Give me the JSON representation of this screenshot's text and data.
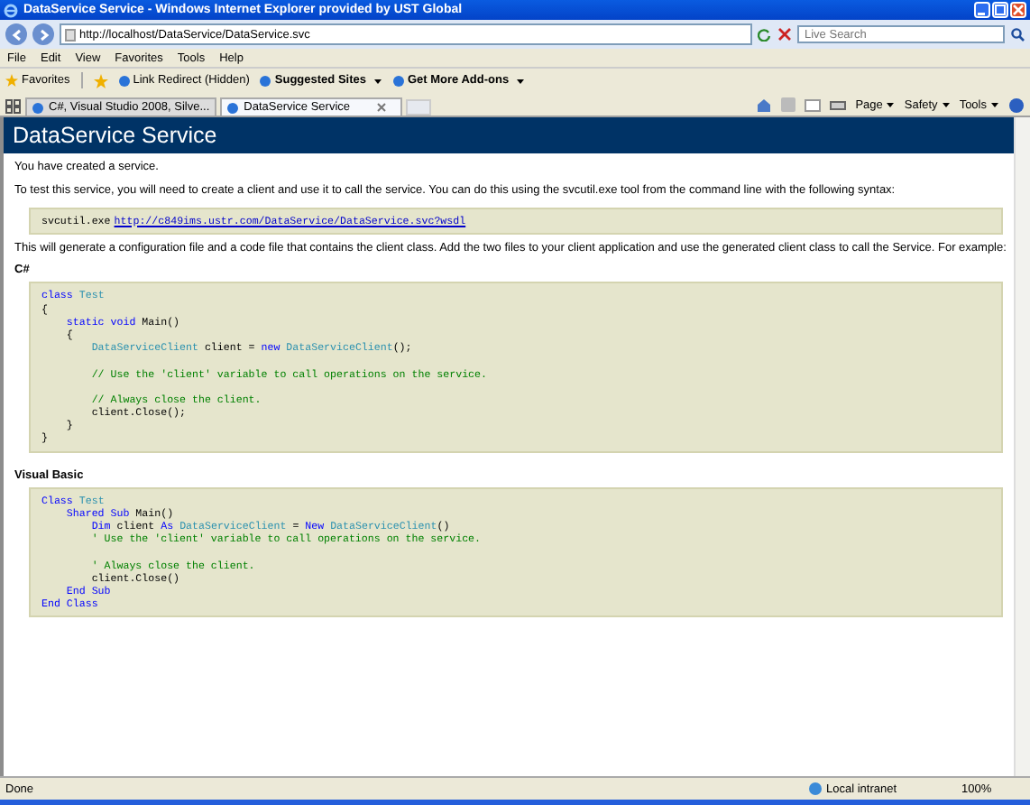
{
  "window": {
    "title": "DataService Service - Windows Internet Explorer provided by UST Global"
  },
  "address_bar": {
    "url": "http://localhost/DataService/DataService.svc"
  },
  "search": {
    "placeholder": "Live Search"
  },
  "menu": [
    "File",
    "Edit",
    "View",
    "Favorites",
    "Tools",
    "Help"
  ],
  "favorites_bar": {
    "favorites": "Favorites",
    "links": [
      {
        "label": "Link Redirect (Hidden)",
        "bold": false,
        "dropdown": false
      },
      {
        "label": "Suggested Sites",
        "bold": true,
        "dropdown": true
      },
      {
        "label": "Get More Add-ons",
        "bold": true,
        "dropdown": true
      }
    ]
  },
  "tabs": [
    {
      "label": "C#, Visual Studio 2008, Silve...",
      "selected": false
    },
    {
      "label": "DataService Service",
      "selected": true
    }
  ],
  "command_bar": [
    "Page",
    "Safety",
    "Tools"
  ],
  "page": {
    "heading": "DataService Service",
    "intro": "You have created a service.",
    "instructions": "To test this service, you will need to create a client and use it to call the service. You can do this using the svcutil.exe tool from the command line with the following syntax:",
    "command": {
      "prefix": "svcutil.exe",
      "link": "http://c849ims.ustr.com/DataService/DataService.svc?wsdl"
    },
    "generate": "This will generate a configuration file and a code file that contains the client class. Add the two files to your client application and use the generated client class to call the Service. For example:",
    "sections": [
      {
        "heading": "C#",
        "lines": [
          {
            "kind": "code",
            "tokens": [
              {
                "kind": "keyword",
                "text": "class"
              },
              {
                "kind": "type",
                "text": " Test"
              }
            ]
          },
          {
            "kind": "code",
            "tokens": [
              {
                "kind": "plain",
                "text": "{"
              }
            ]
          },
          {
            "kind": "code",
            "tokens": [
              {
                "kind": "keyword",
                "text": "    static void"
              },
              {
                "kind": "plain",
                "text": " Main()"
              }
            ]
          },
          {
            "kind": "code",
            "tokens": [
              {
                "kind": "plain",
                "text": "    {"
              }
            ]
          },
          {
            "kind": "code",
            "tokens": [
              {
                "kind": "type",
                "text": "        DataServiceClient"
              },
              {
                "kind": "plain",
                "text": " client = "
              },
              {
                "kind": "keyword",
                "text": "new"
              },
              {
                "kind": "type",
                "text": " DataServiceClient"
              },
              {
                "kind": "plain",
                "text": "();"
              }
            ]
          },
          {
            "kind": "blank"
          },
          {
            "kind": "code",
            "tokens": [
              {
                "kind": "comment",
                "text": "        // Use the 'client' variable to call operations on the service."
              }
            ]
          },
          {
            "kind": "blank"
          },
          {
            "kind": "code",
            "tokens": [
              {
                "kind": "comment",
                "text": "        // Always close the client."
              }
            ]
          },
          {
            "kind": "code",
            "tokens": [
              {
                "kind": "plain",
                "text": "        client.Close();"
              }
            ]
          },
          {
            "kind": "code",
            "tokens": [
              {
                "kind": "plain",
                "text": "    }"
              }
            ]
          },
          {
            "kind": "code",
            "tokens": [
              {
                "kind": "plain",
                "text": "}"
              }
            ]
          }
        ]
      },
      {
        "heading": "Visual Basic",
        "lines": [
          {
            "kind": "code",
            "tokens": [
              {
                "kind": "keyword",
                "text": "Class"
              },
              {
                "kind": "type",
                "text": " Test"
              }
            ]
          },
          {
            "kind": "code",
            "tokens": [
              {
                "kind": "keyword",
                "text": "    Shared Sub"
              },
              {
                "kind": "plain",
                "text": " Main()"
              }
            ]
          },
          {
            "kind": "code",
            "tokens": [
              {
                "kind": "keyword",
                "text": "        Dim"
              },
              {
                "kind": "plain",
                "text": " client "
              },
              {
                "kind": "keyword",
                "text": "As"
              },
              {
                "kind": "type",
                "text": " DataServiceClient"
              },
              {
                "kind": "plain",
                "text": " = "
              },
              {
                "kind": "keyword",
                "text": "New"
              },
              {
                "kind": "type",
                "text": " DataServiceClient"
              },
              {
                "kind": "plain",
                "text": "()"
              }
            ]
          },
          {
            "kind": "code",
            "tokens": [
              {
                "kind": "comment",
                "text": "        ' Use the 'client' variable to call operations on the service."
              }
            ]
          },
          {
            "kind": "blank"
          },
          {
            "kind": "code",
            "tokens": [
              {
                "kind": "comment",
                "text": "        ' Always close the client."
              }
            ]
          },
          {
            "kind": "code",
            "tokens": [
              {
                "kind": "plain",
                "text": "        client.Close()"
              }
            ]
          },
          {
            "kind": "code",
            "tokens": [
              {
                "kind": "keyword",
                "text": "    End Sub"
              }
            ]
          },
          {
            "kind": "code",
            "tokens": [
              {
                "kind": "keyword",
                "text": "End Class"
              }
            ]
          }
        ]
      }
    ]
  },
  "status_bar": {
    "status": "Done",
    "zone": "Local intranet",
    "zoom": "100%"
  }
}
